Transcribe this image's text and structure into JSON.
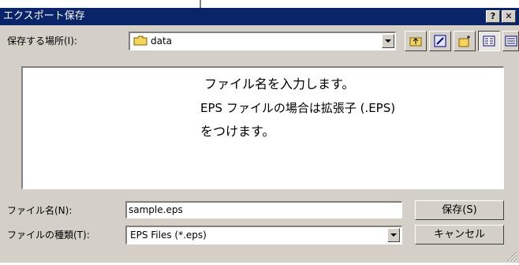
{
  "window": {
    "title": "エクスポート保存",
    "help_button": "?",
    "close_button": "✕"
  },
  "location": {
    "label": "保存する場所(I):",
    "value": "data"
  },
  "annotation": {
    "line1": "ファイル名を入力します。",
    "line2": "EPS ファイルの場合は拡張子 (.EPS)",
    "line3": "をつけます。"
  },
  "filename": {
    "label": "ファイル名(N):",
    "value": "sample.eps"
  },
  "filetype": {
    "label": "ファイルの種類(T):",
    "value": "EPS Files (*.eps)"
  },
  "buttons": {
    "save": "保存(S)",
    "cancel": "キャンセル"
  },
  "icons": {
    "folder": "folder-icon",
    "up_folder": "up-folder-icon",
    "desktop": "desktop-icon",
    "new_folder": "new-folder-icon",
    "list_view": "list-view-icon",
    "details_view": "details-view-icon"
  }
}
